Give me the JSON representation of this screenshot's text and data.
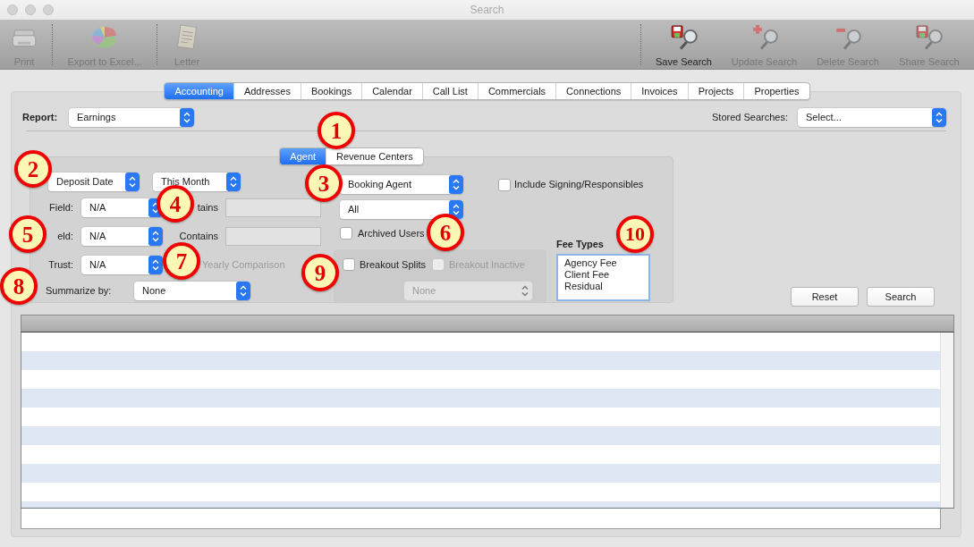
{
  "window": {
    "title": "Search"
  },
  "toolbar": {
    "left": [
      {
        "label": "Print",
        "disabled": true
      },
      {
        "label": "Export to Excel...",
        "disabled": true
      },
      {
        "label": "Letter",
        "disabled": true
      }
    ],
    "right": [
      {
        "label": "Save Search",
        "disabled": false
      },
      {
        "label": "Update Search",
        "disabled": true
      },
      {
        "label": "Delete Search",
        "disabled": true
      },
      {
        "label": "Share Search",
        "disabled": true
      }
    ]
  },
  "tabs": [
    {
      "label": "Accounting",
      "selected": true
    },
    {
      "label": "Addresses",
      "selected": false
    },
    {
      "label": "Bookings",
      "selected": false
    },
    {
      "label": "Calendar",
      "selected": false
    },
    {
      "label": "Call List",
      "selected": false
    },
    {
      "label": "Commercials",
      "selected": false
    },
    {
      "label": "Connections",
      "selected": false
    },
    {
      "label": "Invoices",
      "selected": false
    },
    {
      "label": "Projects",
      "selected": false
    },
    {
      "label": "Properties",
      "selected": false
    }
  ],
  "report": {
    "label": "Report:",
    "value": "Earnings"
  },
  "stored_searches": {
    "label": "Stored Searches:",
    "value": "Select..."
  },
  "subtabs": [
    {
      "label": "Agent",
      "selected": true
    },
    {
      "label": "Revenue Centers",
      "selected": false
    }
  ],
  "date_filter": {
    "field": "Deposit Date",
    "range": "This Month"
  },
  "field_rows": [
    {
      "label": "Field:",
      "value": "N/A",
      "contains_label": "tains",
      "input_disabled": true
    },
    {
      "label": "eld:",
      "value": "N/A",
      "contains_label": "Contains",
      "input_disabled": true
    }
  ],
  "trust": {
    "label": "Trust:",
    "value": "N/A"
  },
  "yearly_comparison": {
    "label": "Yearly Comparison",
    "disabled": true
  },
  "summarize": {
    "label": "Summarize by:",
    "value": "None"
  },
  "agent": {
    "role": "Booking Agent",
    "user": "All"
  },
  "include_signing": {
    "label": "Include Signing/Responsibles",
    "checked": false
  },
  "archived_users": {
    "label": "Archived Users",
    "checked": false
  },
  "breakout": {
    "splits": {
      "label": "Breakout Splits",
      "checked": false,
      "disabled": false
    },
    "inactive": {
      "label": "Breakout Inactive",
      "checked": false,
      "disabled": true
    },
    "select": {
      "value": "None",
      "disabled": true
    }
  },
  "fee_types": {
    "label": "Fee Types",
    "items": [
      {
        "label": "Agency Fee",
        "selected": false
      },
      {
        "label": "Client Fee",
        "selected": false
      },
      {
        "label": "Residual",
        "selected": false
      }
    ]
  },
  "buttons": [
    "Reset",
    "Search"
  ],
  "callouts": [
    "1",
    "2",
    "3",
    "4",
    "5",
    "6",
    "7",
    "8",
    "9",
    "10"
  ]
}
